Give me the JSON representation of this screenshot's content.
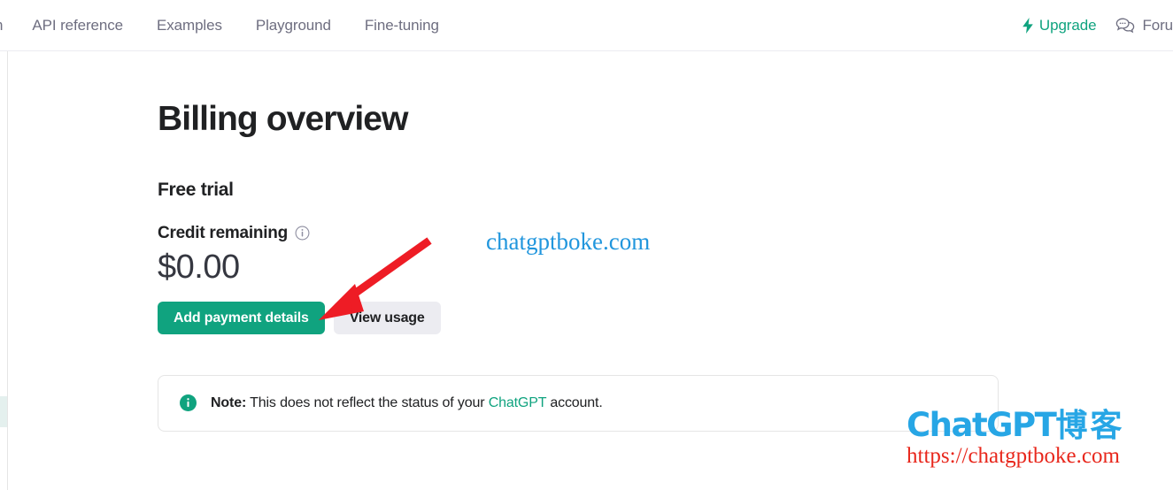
{
  "topbar": {
    "nav_items": [
      {
        "label": "n",
        "name": "nav-documentation-clipped",
        "clipped": true
      },
      {
        "label": "API reference",
        "name": "nav-api-reference",
        "clipped": false
      },
      {
        "label": "Examples",
        "name": "nav-examples",
        "clipped": false
      },
      {
        "label": "Playground",
        "name": "nav-playground",
        "clipped": false
      },
      {
        "label": "Fine-tuning",
        "name": "nav-fine-tuning",
        "clipped": false
      }
    ],
    "upgrade_label": "Upgrade",
    "upgrade_icon": "lightning-bolt-icon",
    "forum_label": "Foru",
    "forum_icon": "chat-bubble-icon",
    "upgrade_color": "#10a37f",
    "nav_text_color": "#6e6e80"
  },
  "main": {
    "page_title": "Billing overview",
    "plan_title": "Free trial",
    "credit_label": "Credit remaining",
    "credit_info_icon": "info-circle-icon",
    "credit_amount": "$0.00",
    "primary_button": "Add payment details",
    "secondary_button": "View usage",
    "primary_button_color": "#10a37f",
    "secondary_button_color": "#ececf1"
  },
  "note": {
    "icon": "info-circle-filled-icon",
    "lead": "Note:",
    "body_before": " This does not reflect the status of your ",
    "link": "ChatGPT",
    "body_after": " account.",
    "link_color": "#10a37f"
  },
  "annotation": {
    "arrow_color": "#ee1c25",
    "arrow_from": "485,272",
    "arrow_to": "362,361"
  },
  "watermarks": {
    "inline_url": "chatgptboke.com",
    "inline_url_color": "#2196dd",
    "logo_brand_en": "ChatGPT",
    "logo_brand_cn": "博客",
    "logo_brand_color": "#27a6e5",
    "logo_url": "https://chatgptboke.com",
    "logo_url_color": "#e8271c"
  }
}
